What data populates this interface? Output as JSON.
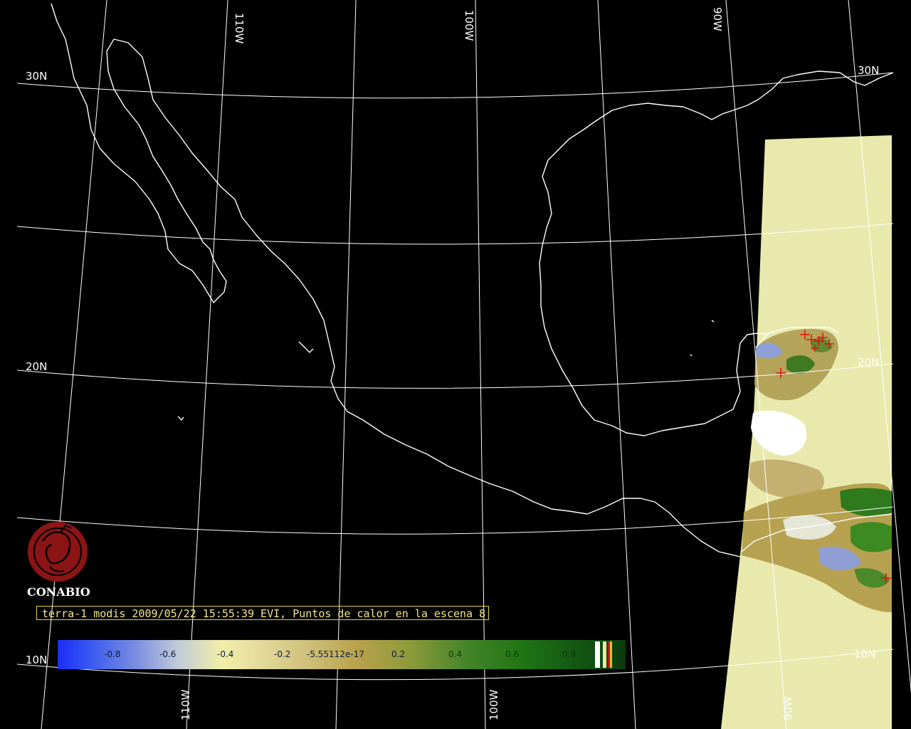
{
  "grid_labels": {
    "lat_30n_left": "30N",
    "lat_30n_right": "30N",
    "lat_20n_left": "20N",
    "lat_20n_right": "20N",
    "lat_10n_left": "10N",
    "lat_10n_right": "10N",
    "lon_110w_top": "110W",
    "lon_100w_top": "100W",
    "lon_90w_top": "90W",
    "lon_110w_bottom": "110W",
    "lon_100w_bottom": "100W",
    "lon_90w_bottom": "90W"
  },
  "logo": {
    "text": "CONABIO",
    "color": "#8b1414"
  },
  "caption": "terra-1 modis 2009/05/22 15:55:39 EVI, Puntos de calor en la escena 8",
  "colorbar": {
    "ticks": [
      "-0.8",
      "-0.6",
      "-0.4",
      "-0.2",
      "-5.55112e-17",
      "0.2",
      "0.4",
      "0.6",
      "0.8"
    ],
    "stripe_colors": [
      "#ffffff",
      "#f2e9a0",
      "#b21c1c",
      "#e6c22a"
    ]
  },
  "fire_hotspots": {
    "count": 8,
    "marker_color": "#e01010"
  },
  "colors": {
    "background": "#000000",
    "coastline": "#ffffff",
    "grid": "#ffffff",
    "swath_fill": "#e9e9ae",
    "caption_text": "#f2e78a",
    "caption_border": "#e6d33a"
  }
}
